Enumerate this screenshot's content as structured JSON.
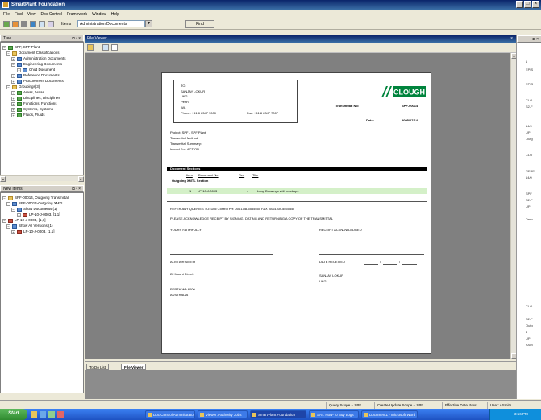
{
  "window": {
    "title": "SmartPlant Foundation"
  },
  "menu": [
    "File",
    "Find",
    "View",
    "Doc Control",
    "Framework",
    "Window",
    "Help"
  ],
  "toolbar": {
    "items_label": "Items",
    "items_value": "Administration Documents",
    "find_label": "Find"
  },
  "tree_panel": {
    "title": "Tree",
    "items": [
      {
        "label": "SPF, SPF Plant",
        "icon": "plant-icon"
      },
      {
        "label": "Document Classifications",
        "icon": "folder-icon"
      },
      {
        "label": "Administration Documents",
        "icon": "folder-icon"
      },
      {
        "label": "Engineering Documents",
        "icon": "folder-icon"
      },
      {
        "label": "Child Document",
        "icon": "folder-icon"
      },
      {
        "label": "Reference Documents",
        "icon": "folder-icon"
      },
      {
        "label": "Procurement Documents",
        "icon": "folder-icon"
      },
      {
        "label": "Groupings(3)",
        "icon": "folder-icon"
      },
      {
        "label": "Areas, Areas",
        "icon": "folder-icon"
      },
      {
        "label": "Disciplines, Disciplines",
        "icon": "folder-icon"
      },
      {
        "label": "Functions, Functions",
        "icon": "folder-icon"
      },
      {
        "label": "Systems, Systems",
        "icon": "folder-icon"
      },
      {
        "label": "Fluids, Fluids",
        "icon": "folder-icon"
      }
    ]
  },
  "new_items_panel": {
    "title": "New Items",
    "items": [
      {
        "label": "SPF-00014, Outgoing Transmittal"
      },
      {
        "label": "SPF-00014-Outgoing XMTL"
      },
      {
        "label": "Show Documents (1)"
      },
      {
        "label": "LP-10-J-0003, [1,1]"
      },
      {
        "label": "LP-10-J-0003, [1,1]"
      },
      {
        "label": "Show All Versions (1)"
      },
      {
        "label": "LP-10-J-0003, [1,1]"
      }
    ]
  },
  "file_viewer": {
    "title": "File Viewer",
    "doc": {
      "to_label": "TO:",
      "to_name": "SANJAY LOKUR",
      "to_org": "UKG",
      "to_city": "Perth",
      "to_state": "WA",
      "phone": "Phone: +61 8 6347 7000",
      "fax": "Fax: +61 8 6347 7007",
      "logo_text": "CLOUGH",
      "transmittal_no_label": "Transmittal No:",
      "transmittal_no": "SPF-00014",
      "date_label": "Date:",
      "date": "2005/07/14",
      "project": "Project: SPF - SPF Plant",
      "method": "Transmittal Method:",
      "summary": "Transmittal Summary:",
      "issued_for": "Issued For: ACTION",
      "sections_title": "Document Sections",
      "col_item": "Item",
      "col_docno": "Document No.",
      "col_rev": "Rev",
      "col_title": "Title",
      "section_name": "Outgoing XMTL Section",
      "row_item": "1",
      "row_docno": "LP-10-J-0003",
      "row_rev": "-",
      "row_title": "Loop Drawings with markups",
      "queries": "REFER ANY QUERIES TO: Doc Control   PH: 0061-08-5555555   FAX: 0061-08-5555557",
      "acknowledge": "PLEASE ACKNOWLEDGE RECEIPT BY SIGNING, DATING AND RETURNING A COPY OF THE TRANSMITTAL",
      "yours": "YOURS FAITHFULLY",
      "receipt": "RECEIPT ACKNOWLEDGED",
      "sender_name": "ALISTAIR SMITH",
      "sender_street": "22 Mount Street",
      "date_received": "DATE RECEIVED",
      "recv_name": "SANJAY LOKUR",
      "recv_org": "UKG",
      "sender_city": "PERTH  WA  6000",
      "sender_country": "AUSTRALIA"
    }
  },
  "bottom_tabs": [
    "To Do List",
    "File Viewer"
  ],
  "status": {
    "query_scope": "Query Scope = SPF",
    "create_scope": "Create/Update Scope = SPF",
    "effective_date": "Effective Date: Now",
    "user": "User: ASmith"
  },
  "taskbar": {
    "start_label": "Start",
    "tasks": [
      "Doc Control Administrator",
      "Viewer: Authority Jobs",
      "SmartPlant Foundation",
      "SAT: How-To Buy Logs",
      "Document1 - Microsoft Word"
    ],
    "clock": "3:16 PM"
  },
  "right_pane_texts": [
    "1",
    "EPIS",
    "EPIS",
    "CLO",
    "S2-F",
    "14/0",
    "UP",
    "Outg",
    "CLO",
    "RESE",
    "14/0",
    "SPF",
    "S2-F",
    "UP",
    "Desc",
    "CLO",
    "S2-F",
    "Outg",
    "1",
    "UP",
    "ASm"
  ]
}
